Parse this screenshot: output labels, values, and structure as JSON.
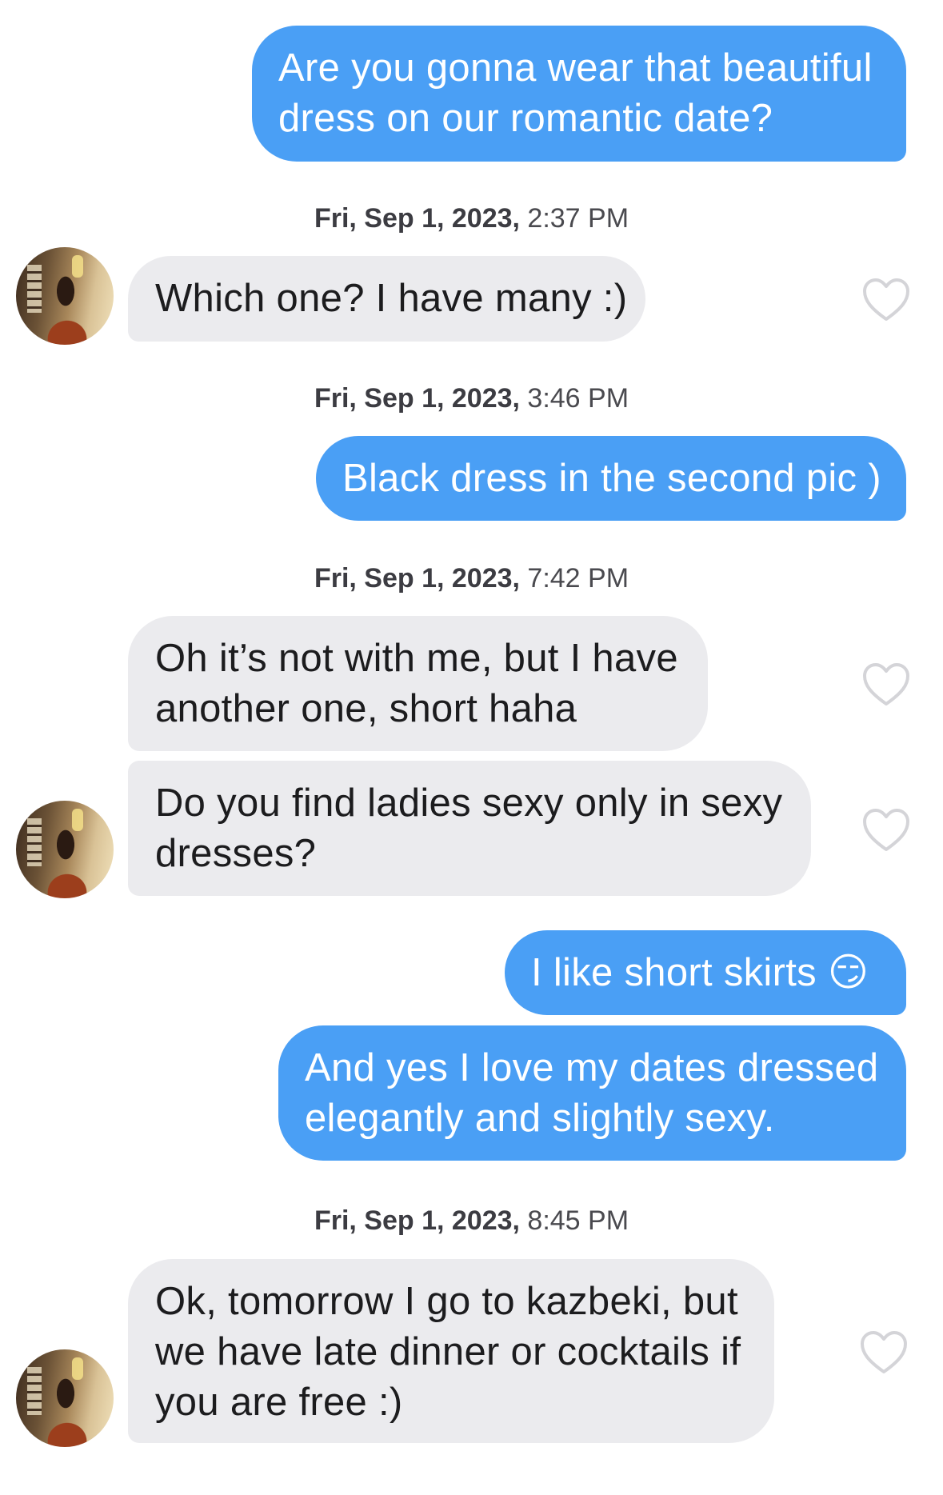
{
  "messages": [
    {
      "type": "out",
      "text_lines": [
        "Are you gonna wear that beautiful",
        "dress on our romantic date?"
      ]
    },
    {
      "type": "stamp",
      "day": "Fri, Sep 1, 2023,",
      "time": "2:37 PM"
    },
    {
      "type": "in",
      "text_lines": [
        "Which one? I have many :)"
      ],
      "liked": false
    },
    {
      "type": "stamp",
      "day": "Fri, Sep 1, 2023,",
      "time": "3:46 PM"
    },
    {
      "type": "out",
      "text_lines": [
        "Black dress in the second pic )"
      ]
    },
    {
      "type": "stamp",
      "day": "Fri, Sep 1, 2023,",
      "time": "7:42 PM"
    },
    {
      "type": "in",
      "text_lines": [
        "Oh it’s not with me, but I have",
        "another one, short haha"
      ],
      "liked": false
    },
    {
      "type": "in",
      "text_lines": [
        "Do you find ladies sexy only in sexy",
        "dresses?"
      ],
      "liked": false
    },
    {
      "type": "out",
      "text_lines": [
        "I like short skirts 😏"
      ]
    },
    {
      "type": "out",
      "text_lines": [
        "And yes I love my dates dressed",
        "elegantly and slightly sexy."
      ]
    },
    {
      "type": "stamp",
      "day": "Fri, Sep 1, 2023,",
      "time": "8:45 PM"
    },
    {
      "type": "in",
      "text_lines": [
        "Ok, tomorrow I go to kazbeki, but",
        "we have late dinner or cocktails if",
        "you are free :)"
      ],
      "liked": false
    }
  ],
  "icons": {
    "like": "heart-outline-icon",
    "avatar": "match-avatar"
  },
  "colors": {
    "outgoing_bubble": "#4a9ff5",
    "incoming_bubble": "#ebebee",
    "heart_outline": "#d4d4d8"
  }
}
